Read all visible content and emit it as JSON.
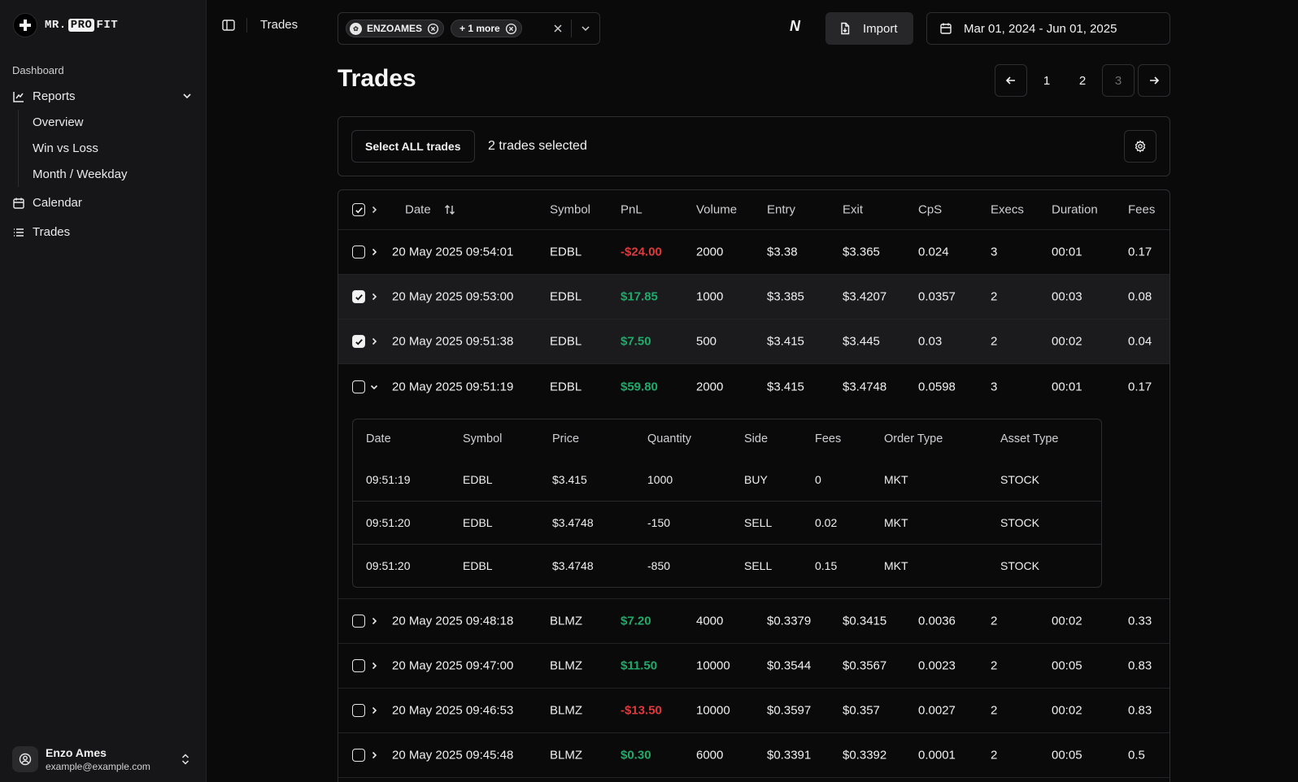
{
  "app": {
    "logo_left": "MR.",
    "logo_mid": "PRO",
    "logo_right": "FIT"
  },
  "sidebar": {
    "section": "Dashboard",
    "reports": "Reports",
    "sub": [
      "Overview",
      "Win vs Loss",
      "Month / Weekday"
    ],
    "calendar": "Calendar",
    "trades": "Trades",
    "user": {
      "name": "Enzo Ames",
      "email": "example@example.com"
    }
  },
  "topbar": {
    "breadcrumb": "Trades",
    "filters": [
      {
        "label": "ENZOAMES"
      },
      {
        "label": "+ 1 more"
      }
    ],
    "n_logo": "N",
    "import_label": "Import",
    "date_range": "Mar 01, 2024 - Jun 01, 2025"
  },
  "page": {
    "title": "Trades"
  },
  "pagination": {
    "pages": [
      "1",
      "2",
      "3"
    ],
    "current": "3"
  },
  "selection": {
    "select_all_label": "Select ALL trades",
    "count_text": "2 trades selected"
  },
  "table": {
    "columns": [
      "Date",
      "Symbol",
      "PnL",
      "Volume",
      "Entry",
      "Exit",
      "CpS",
      "Execs",
      "Duration",
      "Fees"
    ],
    "rows": [
      {
        "date": "20 May 2025 09:54:01",
        "symbol": "EDBL",
        "pnl": "-$24.00",
        "volume": "2000",
        "entry": "$3.38",
        "exit": "$3.365",
        "cps": "0.024",
        "execs": "3",
        "duration": "00:01",
        "fees": "0.17",
        "checked": false
      },
      {
        "date": "20 May 2025 09:53:00",
        "symbol": "EDBL",
        "pnl": "$17.85",
        "volume": "1000",
        "entry": "$3.385",
        "exit": "$3.4207",
        "cps": "0.0357",
        "execs": "2",
        "duration": "00:03",
        "fees": "0.08",
        "checked": true
      },
      {
        "date": "20 May 2025 09:51:38",
        "symbol": "EDBL",
        "pnl": "$7.50",
        "volume": "500",
        "entry": "$3.415",
        "exit": "$3.445",
        "cps": "0.03",
        "execs": "2",
        "duration": "00:02",
        "fees": "0.04",
        "checked": true
      },
      {
        "date": "20 May 2025 09:51:19",
        "symbol": "EDBL",
        "pnl": "$59.80",
        "volume": "2000",
        "entry": "$3.415",
        "exit": "$3.4748",
        "cps": "0.0598",
        "execs": "3",
        "duration": "00:01",
        "fees": "0.17",
        "checked": false
      },
      {
        "date": "20 May 2025 09:48:18",
        "symbol": "BLMZ",
        "pnl": "$7.20",
        "volume": "4000",
        "entry": "$0.3379",
        "exit": "$0.3415",
        "cps": "0.0036",
        "execs": "2",
        "duration": "00:02",
        "fees": "0.33",
        "checked": false
      },
      {
        "date": "20 May 2025 09:47:00",
        "symbol": "BLMZ",
        "pnl": "$11.50",
        "volume": "10000",
        "entry": "$0.3544",
        "exit": "$0.3567",
        "cps": "0.0023",
        "execs": "2",
        "duration": "00:05",
        "fees": "0.83",
        "checked": false
      },
      {
        "date": "20 May 2025 09:46:53",
        "symbol": "BLMZ",
        "pnl": "-$13.50",
        "volume": "10000",
        "entry": "$0.3597",
        "exit": "$0.357",
        "cps": "0.0027",
        "execs": "2",
        "duration": "00:02",
        "fees": "0.83",
        "checked": false
      },
      {
        "date": "20 May 2025 09:45:48",
        "symbol": "BLMZ",
        "pnl": "$0.30",
        "volume": "6000",
        "entry": "$0.3391",
        "exit": "$0.3392",
        "cps": "0.0001",
        "execs": "2",
        "duration": "00:05",
        "fees": "0.5",
        "checked": false
      }
    ],
    "executions": {
      "columns": [
        "Date",
        "Symbol",
        "Price",
        "Quantity",
        "Side",
        "Fees",
        "Order Type",
        "Asset Type"
      ],
      "rows": [
        {
          "date": "09:51:19",
          "symbol": "EDBL",
          "price": "$3.415",
          "quantity": "1000",
          "side": "BUY",
          "fees": "0",
          "order_type": "MKT",
          "asset_type": "STOCK"
        },
        {
          "date": "09:51:20",
          "symbol": "EDBL",
          "price": "$3.4748",
          "quantity": "-150",
          "side": "SELL",
          "fees": "0.02",
          "order_type": "MKT",
          "asset_type": "STOCK"
        },
        {
          "date": "09:51:20",
          "symbol": "EDBL",
          "price": "$3.4748",
          "quantity": "-850",
          "side": "SELL",
          "fees": "0.15",
          "order_type": "MKT",
          "asset_type": "STOCK"
        }
      ]
    }
  },
  "colors": {
    "positive": "#1faa6b",
    "negative": "#e0393b",
    "background": "#0a0a0b",
    "sidebar": "#161618"
  }
}
